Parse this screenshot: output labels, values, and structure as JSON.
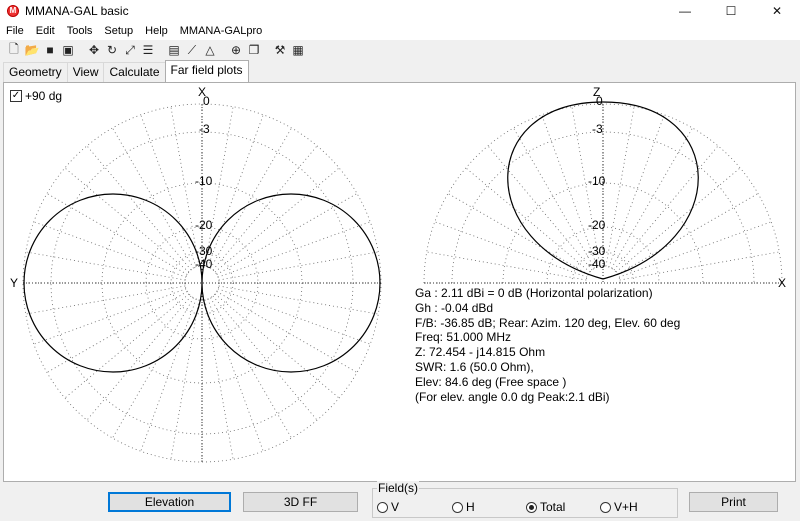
{
  "window": {
    "title": "MMANA-GAL basic",
    "minimize": "—",
    "maximize": "☐",
    "close": "✕"
  },
  "menu": [
    "File",
    "Edit",
    "Tools",
    "Setup",
    "Help",
    "MMANA-GALpro"
  ],
  "toolbar_icons": [
    "new-file-icon",
    "open-folder-icon",
    "save-icon",
    "save-as-icon",
    "move-icon",
    "rotate-icon",
    "stretch-icon",
    "list-icon",
    "document-icon",
    "graph-icon",
    "triangle-icon",
    "crosshair-icon",
    "copy-icon",
    "wrench-icon",
    "calculator-icon"
  ],
  "tabs": [
    {
      "label": "Geometry",
      "active": false
    },
    {
      "label": "View",
      "active": false
    },
    {
      "label": "Calculate",
      "active": false
    },
    {
      "label": "Far field plots",
      "active": true
    }
  ],
  "plot": {
    "checkbox_label": "+90 dg",
    "checkbox_checked": true,
    "left_axes": {
      "top": "X",
      "left": "Y"
    },
    "right_axes": {
      "top": "Z",
      "right": "X"
    },
    "db_levels": [
      "0",
      "-3",
      "-10",
      "-20",
      "-30",
      "-40"
    ],
    "info": [
      "Ga : 2.11 dBi = 0 dB  (Horizontal polarization)",
      "Gh : -0.04 dBd",
      "F/B: -36.85 dB; Rear: Azim. 120 deg,  Elev. 60 deg",
      "Freq: 51.000 MHz",
      "Z: 72.454 - j14.815 Ohm",
      "SWR: 1.6 (50.0 Ohm),",
      "Elev: 84.6 deg (Free space )",
      "(For elev. angle 0.0 dg Peak:2.1 dBi)"
    ]
  },
  "bottom": {
    "elevation_button": "Elevation",
    "ff3d_button": "3D FF",
    "field_group_label": "Field(s)",
    "field_options": [
      {
        "label": "V",
        "selected": false
      },
      {
        "label": "H",
        "selected": false
      },
      {
        "label": "Total",
        "selected": true
      },
      {
        "label": "V+H",
        "selected": false
      }
    ],
    "print_button": "Print"
  },
  "colors": {
    "accent": "#0078d7",
    "grid": "#555555",
    "pattern": "#000000"
  }
}
